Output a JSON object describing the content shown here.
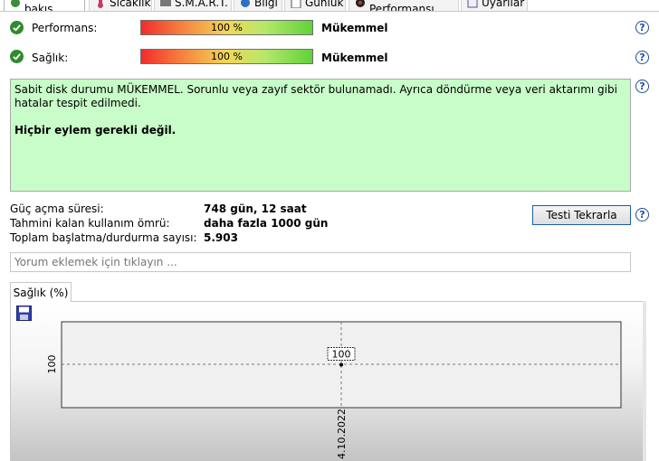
{
  "tabs": [
    {
      "label": "Genel bakış",
      "icon": "overview-icon"
    },
    {
      "label": "Sıcaklık",
      "icon": "thermometer-icon"
    },
    {
      "label": "S.M.A.R.T.",
      "icon": "smart-icon"
    },
    {
      "label": "Bilgi",
      "icon": "info-icon"
    },
    {
      "label": "Günlük",
      "icon": "log-icon"
    },
    {
      "label": "Disk Performansı",
      "icon": "disk-performance-icon"
    },
    {
      "label": "Uyarılar",
      "icon": "alerts-icon"
    }
  ],
  "performance": {
    "label": "Performans:",
    "value_text": "100 %",
    "status": "Mükemmel",
    "level": 100
  },
  "health": {
    "label": "Sağlık:",
    "value_text": "100 %",
    "status": "Mükemmel",
    "level": 100
  },
  "message": {
    "text": "Sabit disk durumu MÜKEMMEL. Sorunlu veya zayıf sektör bulunamadı. Ayrıca döndürme veya veri aktarımı gibi hatalar tespit edilmedi.",
    "action": "Hiçbir eylem gerekli değil."
  },
  "info": {
    "power_on_label": "Güç açma süresi:",
    "power_on_value": "748 gün, 12 saat",
    "lifetime_label": "Tahmini kalan kullanım ömrü:",
    "lifetime_value": "daha fazla 1000 gün",
    "startstop_label": "Toplam başlatma/durdurma sayısı:",
    "startstop_value": "5.903"
  },
  "retest_button": "Testi Tekrarla",
  "comment_placeholder": "Yorum eklemek için tıklayın ...",
  "chart_tab": "Sağlık (%)",
  "chart_data": {
    "type": "line",
    "x": [
      "4.10.2022"
    ],
    "series": [
      {
        "values": [
          100
        ]
      }
    ],
    "ylabel_tick": "100",
    "xtick": "4.10.2022",
    "data_label": "100"
  },
  "colors": {
    "message_bg": "#c8fcc8",
    "check_green": "#2e8b2e",
    "help_blue": "#1d4e9c"
  }
}
